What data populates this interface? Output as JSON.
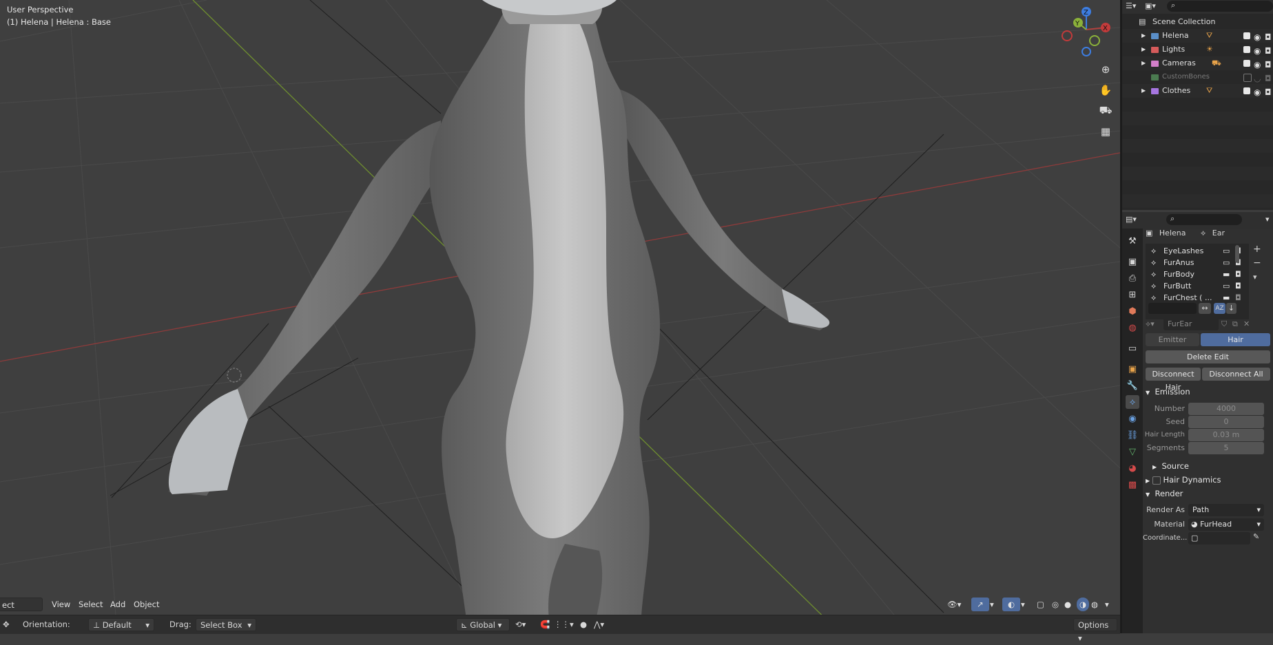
{
  "viewport": {
    "info_line1": "User Perspective",
    "info_line2": "(1) Helena | Helena : Base",
    "gizmo": {
      "z": "Z",
      "y": "Y",
      "x": "X"
    },
    "colors": {
      "x_axis": "#b0413e",
      "y_axis": "#8bb13a",
      "z_axis": "#3d7de0",
      "fur_dark": "#6a6a6a",
      "fur_light": "#bdbdbd",
      "background": "#3f3f3f"
    }
  },
  "viewport_header": {
    "mode": "ect Mode",
    "menu": [
      "View",
      "Select",
      "Add",
      "Object"
    ]
  },
  "tool_header": {
    "orientation_label": "Orientation:",
    "orientation_value": "Default",
    "drag_label": "Drag:",
    "drag_value": "Select Box",
    "transform": "Global",
    "options": "Options"
  },
  "outliner": {
    "search_icon": "search-icon",
    "root": "Scene Collection",
    "items": [
      {
        "label": "Helena",
        "color": "#5a8fc9",
        "visible": true
      },
      {
        "label": "Lights",
        "color": "#d55b5b",
        "visible": true
      },
      {
        "label": "Cameras",
        "color": "#d37fc9",
        "visible": true
      },
      {
        "label": "CustomBones",
        "color": "#62b36b",
        "visible": false
      },
      {
        "label": "Clothes",
        "color": "#a676e0",
        "visible": true
      }
    ]
  },
  "properties": {
    "breadcrumb_object": "Helena",
    "breadcrumb_data": "Ear",
    "particle_systems": [
      "EyeLashes",
      "FurAnus",
      "FurBody",
      "FurButt",
      "FurChest ( ..."
    ],
    "active_system": "FurEar",
    "type_tabs": [
      "Emitter",
      "Hair"
    ],
    "active_type": "Hair",
    "delete_edit": "Delete Edit",
    "disconnect_hair": "Disconnect Hair",
    "disconnect_all": "Disconnect All",
    "emission": {
      "title": "Emission",
      "fields": [
        {
          "label": "Number",
          "value": "4000"
        },
        {
          "label": "Seed",
          "value": "0"
        },
        {
          "label": "Hair Length",
          "value": "0.03 m"
        },
        {
          "label": "Segments",
          "value": "5"
        }
      ]
    },
    "source": "Source",
    "hair_dynamics": "Hair Dynamics",
    "render": {
      "title": "Render",
      "render_as_label": "Render As",
      "render_as_value": "Path",
      "material_label": "Material",
      "material_value": "FurHead",
      "coordinate_label": "Coordinate..."
    }
  }
}
